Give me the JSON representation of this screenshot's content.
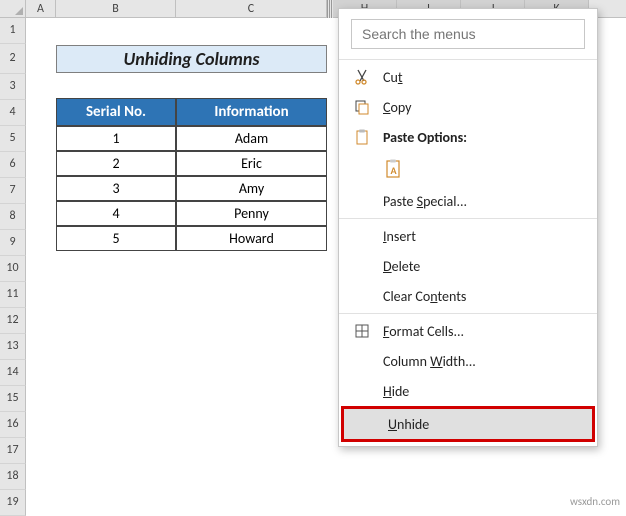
{
  "columns": [
    "A",
    "B",
    "C",
    "H",
    "I",
    "J",
    "K"
  ],
  "rows": [
    "1",
    "2",
    "3",
    "4",
    "5",
    "6",
    "7",
    "8",
    "9",
    "10",
    "11",
    "12",
    "13",
    "14",
    "15",
    "16",
    "17",
    "18",
    "19"
  ],
  "title": "Unhiding Columns",
  "table": {
    "headers": {
      "c1": "Serial No.",
      "c2": "Information"
    },
    "rows": [
      {
        "c1": "1",
        "c2": "Adam"
      },
      {
        "c1": "2",
        "c2": "Eric"
      },
      {
        "c1": "3",
        "c2": "Amy"
      },
      {
        "c1": "4",
        "c2": "Penny"
      },
      {
        "c1": "5",
        "c2": "Howard"
      }
    ]
  },
  "menu": {
    "search_placeholder": "Search the menus",
    "cut": "Cut",
    "copy": "Copy",
    "paste_options": "Paste Options:",
    "paste_special": "Paste Special...",
    "insert": "Insert",
    "delete": "Delete",
    "clear_contents": "Clear Contents",
    "format_cells": "Format Cells...",
    "column_width": "Column Width...",
    "hide": "Hide",
    "unhide": "Unhide"
  },
  "watermark": "wsxdn.com"
}
